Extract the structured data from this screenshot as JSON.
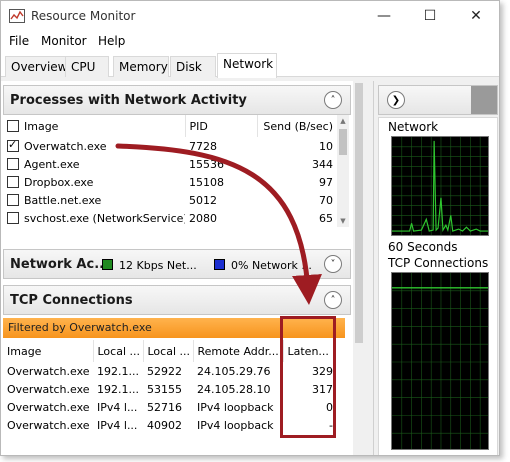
{
  "window": {
    "title": "Resource Monitor"
  },
  "titlebar": {
    "minimize_glyph": "—",
    "maximize_glyph": "☐",
    "close_glyph": "✕"
  },
  "menu": [
    "File",
    "Monitor",
    "Help"
  ],
  "tabs": [
    "Overview",
    "CPU",
    "Memory",
    "Disk",
    "Network"
  ],
  "active_tab": "Network",
  "processes": {
    "title": "Processes with Network Activity",
    "collapse_glyph": "˄",
    "columns": [
      "Image",
      "PID",
      "Send (B/sec)"
    ],
    "rows": [
      {
        "checked": true,
        "image": "Overwatch.exe",
        "pid": "7728",
        "send": "10"
      },
      {
        "checked": false,
        "image": "Agent.exe",
        "pid": "15536",
        "send": "344"
      },
      {
        "checked": false,
        "image": "Dropbox.exe",
        "pid": "15108",
        "send": "97"
      },
      {
        "checked": false,
        "image": "Battle.net.exe",
        "pid": "5012",
        "send": "70"
      },
      {
        "checked": false,
        "image": "svchost.exe (NetworkService)",
        "pid": "2080",
        "send": "65"
      }
    ]
  },
  "network_activity": {
    "title": "Network Ac...",
    "legend1": "12 Kbps Net...",
    "legend2": "0% Network ...",
    "legend1_color": "#1f8a1f",
    "legend2_color": "#1c2fd1",
    "expand_glyph": "˅"
  },
  "tcp": {
    "title": "TCP Connections",
    "collapse_glyph": "˄",
    "filter": "Filtered by Overwatch.exe",
    "columns": [
      "Image",
      "Local ...",
      "Local ...",
      "Remote Addr...",
      "Laten..."
    ],
    "rows": [
      {
        "image": "Overwatch.exe",
        "local_addr": "192.1...",
        "local_port": "52922",
        "remote": "24.105.29.76",
        "latency": "329"
      },
      {
        "image": "Overwatch.exe",
        "local_addr": "192.1...",
        "local_port": "53155",
        "remote": "24.105.28.10",
        "latency": "317"
      },
      {
        "image": "Overwatch.exe",
        "local_addr": "IPv4 l...",
        "local_port": "52716",
        "remote": "IPv4 loopback",
        "latency": "0"
      },
      {
        "image": "Overwatch.exe",
        "local_addr": "IPv4 l...",
        "local_port": "40902",
        "remote": "IPv4 loopback",
        "latency": "-"
      }
    ]
  },
  "right_panel": {
    "nav_glyph": "❯",
    "graph1_label": "Network",
    "graph1_sublabel": "60 Seconds",
    "graph2_label": "TCP Connections"
  },
  "colors": {
    "annotation": "#9e1c22",
    "graph_line": "#2fc62f",
    "filter_bar": "#f7941d"
  }
}
